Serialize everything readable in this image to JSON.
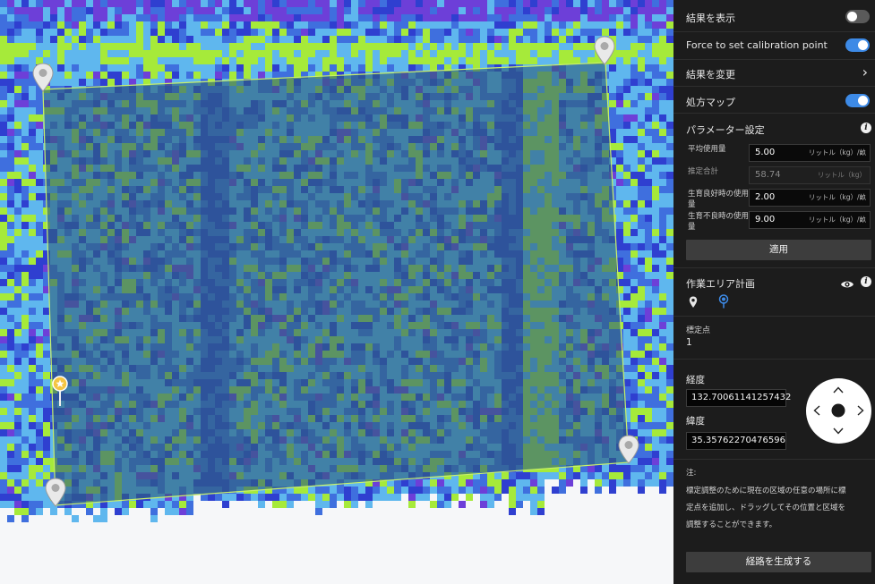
{
  "panel": {
    "show_result": {
      "label": "結果を表示",
      "on": false
    },
    "force_calibration": {
      "label": "Force to set calibration point",
      "on": true
    },
    "change_result": {
      "label": "結果を変更"
    },
    "prescription_map": {
      "label": "処方マップ",
      "on": true
    },
    "parameters": {
      "title": "パラメーター設定",
      "avg_usage": {
        "label": "平均使用量",
        "value": "5.00",
        "unit": "リットル（kg）/畝"
      },
      "estimated_total": {
        "label": "推定合計",
        "value": "58.74",
        "unit": "リットル（kg）"
      },
      "good_growth": {
        "label": "生育良好時の使用量",
        "value": "2.00",
        "unit": "リットル（kg）/畝"
      },
      "poor_growth": {
        "label": "生育不良時の使用量",
        "value": "9.00",
        "unit": "リットル（kg）/畝"
      },
      "apply_label": "適用"
    },
    "work_area": {
      "title": "作業エリア計画"
    },
    "calibration_point": {
      "label": "標定点",
      "value": "1"
    },
    "longitude": {
      "label": "経度",
      "value": "132.70061141257432"
    },
    "latitude": {
      "label": "緯度",
      "value": "35.35762270476596"
    },
    "note": {
      "title": "注:",
      "lines": [
        "標定調整のために現在の区域の任意の場所に標",
        "定点を追加し、ドラッグしてその位置と区域を",
        "調整することができます。"
      ]
    },
    "generate_route_label": "経路を生成する"
  },
  "colors": {
    "panel_bg": "#1c1c1c",
    "toggle_on": "#3d8ae6",
    "map_green": "#a6ea3a",
    "map_lightblue": "#5fb7ee",
    "map_blue": "#3f6fde",
    "map_deepblue": "#2f3fd0",
    "map_purple": "#6d3fd8"
  },
  "icons": {
    "map_pins": "map-pin-icon",
    "calibration_pin": "star-pin-icon",
    "visibility": "eye-icon",
    "info": "info-icon",
    "chevron": "chevron-right-icon"
  }
}
